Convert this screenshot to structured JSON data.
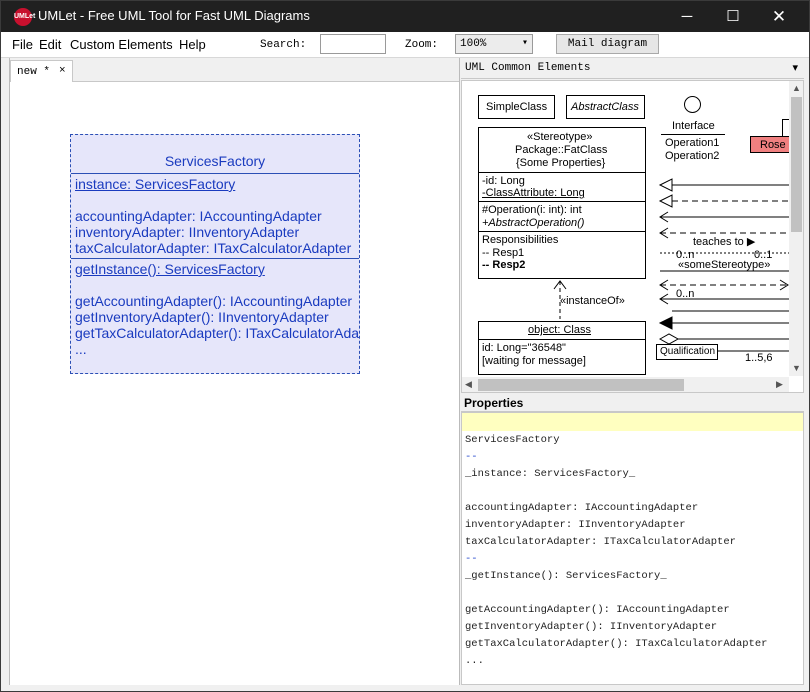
{
  "window": {
    "title": "UMLet - Free UML Tool for Fast UML Diagrams",
    "icon_label": "UMLet",
    "minimize_icon": "─",
    "maximize_icon": "☐",
    "close_icon": "✕"
  },
  "menu": {
    "items": [
      "File",
      "Edit",
      "Custom Elements",
      "Help"
    ]
  },
  "toolbar": {
    "search_label": "Search:",
    "search_value": "",
    "zoom_label": "Zoom:",
    "zoom_value": "100%",
    "mail_button": "Mail diagram"
  },
  "tabs": [
    {
      "label": "new *",
      "close": "×"
    }
  ],
  "diagram": {
    "class_name": "ServicesFactory",
    "static_field": "instance: ServicesFactory",
    "fields": [
      "accountingAdapter: IAccountingAdapter",
      "inventoryAdapter: IInventoryAdapter",
      "taxCalculatorAdapter: ITaxCalculatorAdapter"
    ],
    "static_method": "getInstance(): ServicesFactory",
    "methods": [
      "getAccountingAdapter(): IAccountingAdapter",
      "getInventoryAdapter(): IInventoryAdapter",
      "getTaxCalculatorAdapter(): ITaxCalculatorAdapter"
    ],
    "ellipsis": "..."
  },
  "palette": {
    "title": "UML Common Elements",
    "simple_class": "SimpleClass",
    "abstract_class": "AbstractClass",
    "interface_label": "Interface",
    "interface_ops": [
      "Operation1",
      "Operation2"
    ],
    "rose": "Rose",
    "fat_class": {
      "stereotype": "«Stereotype»",
      "package": "Package::FatClass",
      "props": "{Some Properties}",
      "attrs": [
        "-id: Long",
        "-ClassAttribute: Long"
      ],
      "ops": [
        "#Operation(i: int): int",
        "+AbstractOperation()"
      ],
      "resp_title": "Responsibilities",
      "resp": [
        "-- Resp1",
        "-- Resp2"
      ]
    },
    "instance_of": "«instanceOf»",
    "object": {
      "name": "object: Class",
      "lines": [
        "id: Long=\"36548\"",
        "[waiting for message]"
      ]
    },
    "teaches_to": "teaches to ▶",
    "mult_left": "0..n",
    "mult_right": "0..1",
    "some_stereotype": "«someStereotype»",
    "mult_left2": "0..n",
    "qualification": "Qualification",
    "mult_qual": "1..5,6"
  },
  "properties": {
    "title": "Properties",
    "lines": [
      "ServicesFactory",
      "--",
      "_instance: ServicesFactory_",
      "",
      "accountingAdapter: IAccountingAdapter",
      "inventoryAdapter: IInventoryAdapter",
      "taxCalculatorAdapter: ITaxCalculatorAdapter",
      "--",
      "_getInstance(): ServicesFactory_",
      "",
      "getAccountingAdapter(): IAccountingAdapter",
      "getInventoryAdapter(): IInventoryAdapter",
      "getTaxCalculatorAdapter(): ITaxCalculatorAdapter",
      "..."
    ]
  }
}
